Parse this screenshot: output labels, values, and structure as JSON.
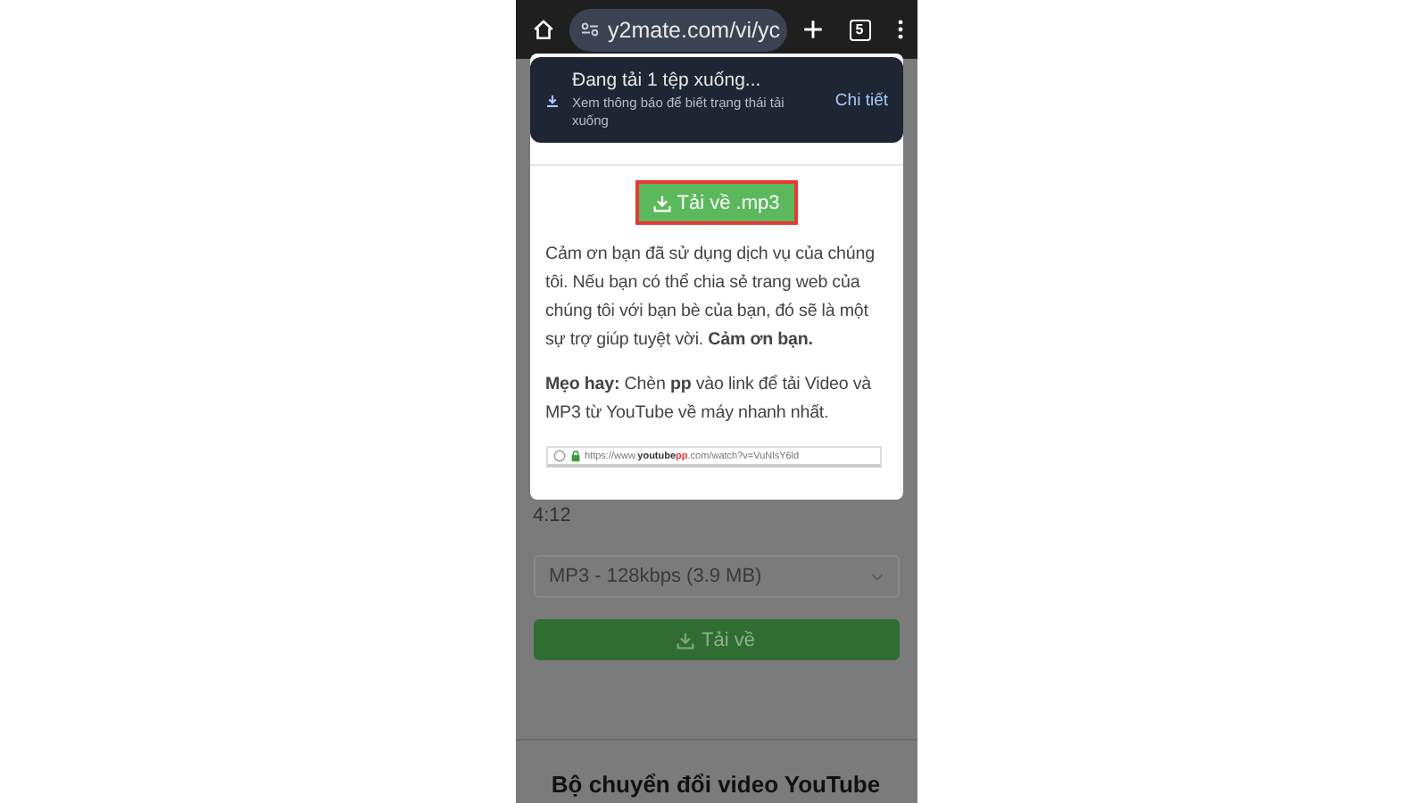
{
  "browser": {
    "url": "y2mate.com/vi/yc",
    "tab_count": "5"
  },
  "download_toast": {
    "title": "Đang tải 1 tệp xuống...",
    "subtitle": "Xem thông báo để biết trạng thái tải xuống",
    "action": "Chi tiết"
  },
  "modal": {
    "button": {
      "label": "Tải về .mp3",
      "focused": true
    },
    "paragraphs": [
      "Cảm ơn bạn đã sử dụng dịch vụ của chúng tôi. Nếu bạn có thể chia sẻ trang web của chúng tôi với bạn bè của bạn, đó sẽ là một sự trợ giúp tuyệt vời. **Cảm ơn bạn.**",
      "**Mẹo hay:** Chèn **pp** vào link để tải Video và MP3 từ YouTube về máy nhanh nhất."
    ],
    "url_example": {
      "prefix": "https://www.",
      "domain": "youtube",
      "highlight": "pp",
      "suffix": ".com/watch?v=VuNlsY6ld"
    }
  },
  "page": {
    "duration": "4:12",
    "format_select": {
      "value": "MP3 - 128kbps (3.9 MB)"
    },
    "download_button": "Tải về",
    "section_heading": "Bộ chuyển đổi video YouTube"
  }
}
